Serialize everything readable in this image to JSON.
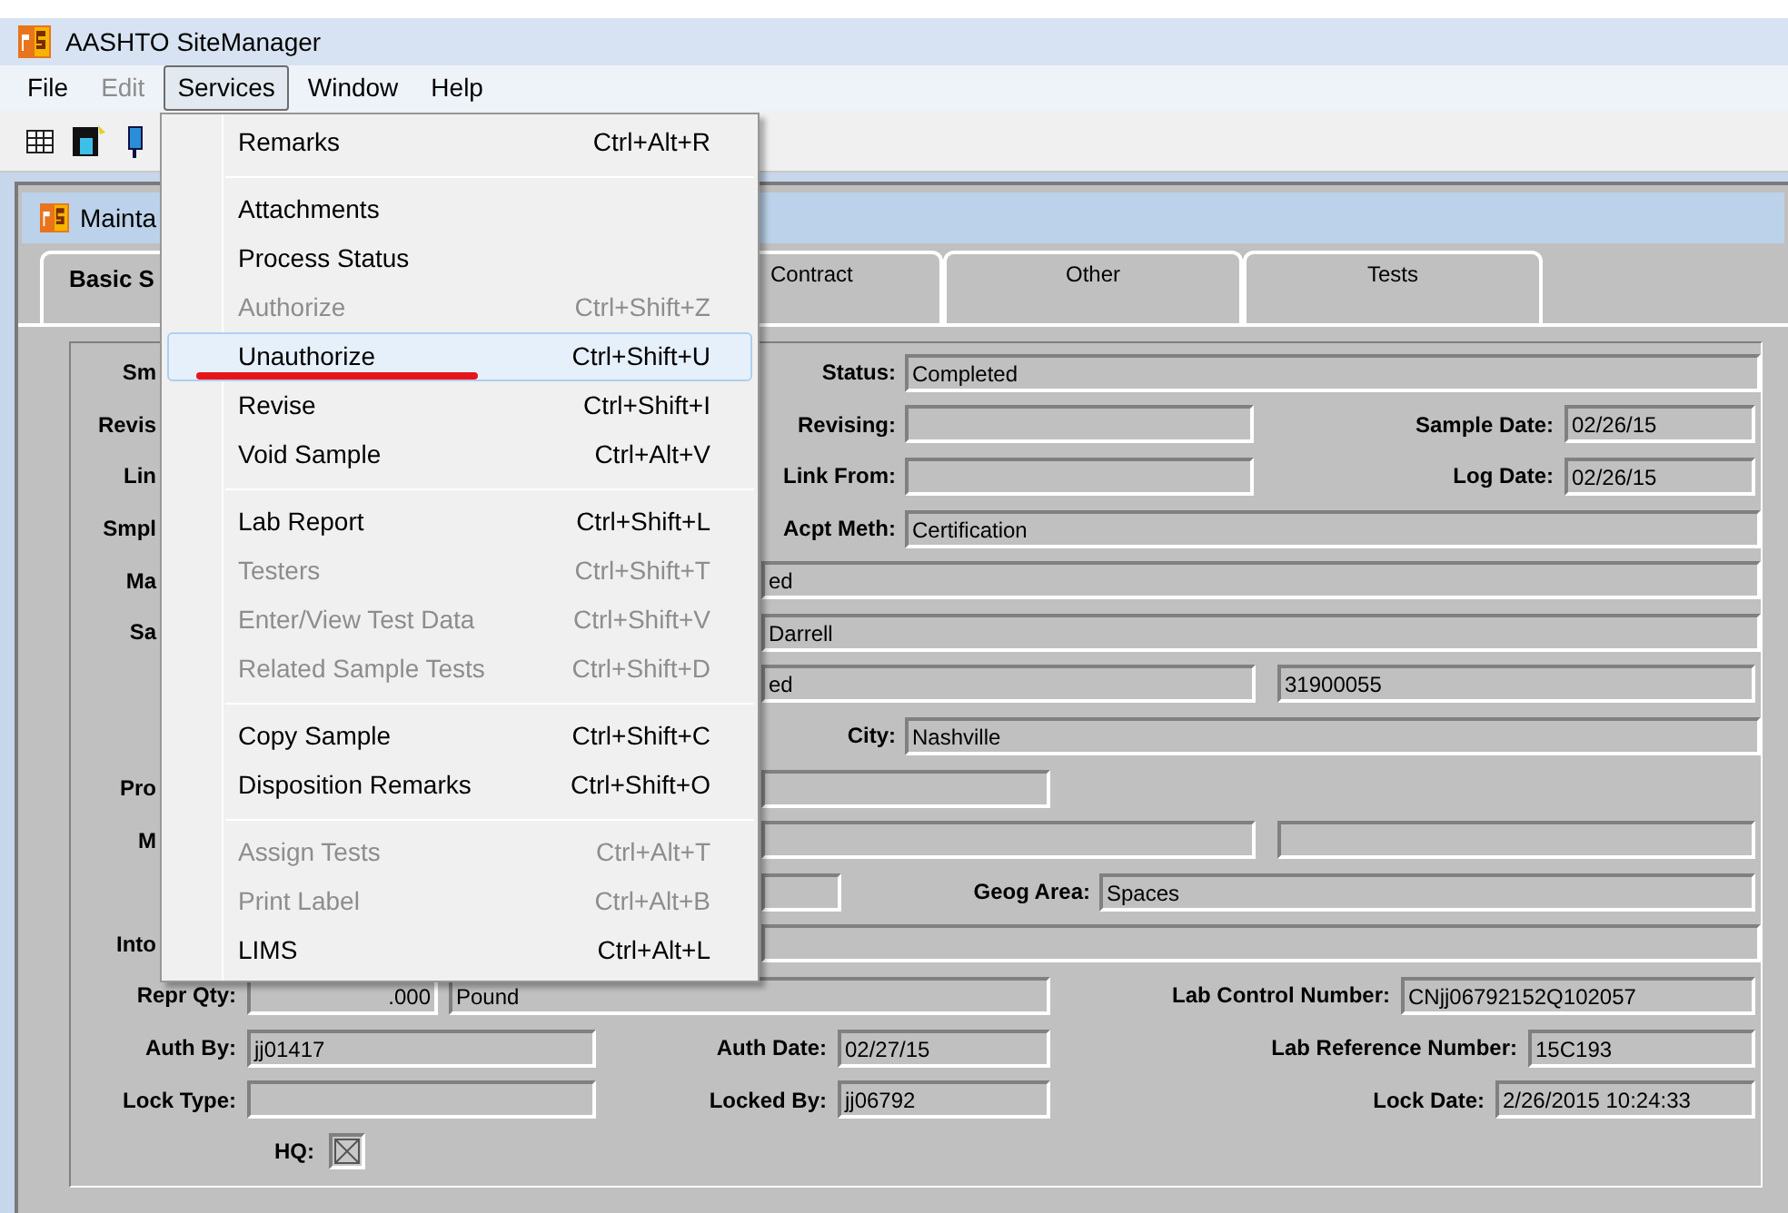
{
  "window": {
    "title": "AASHTO SiteManager"
  },
  "menubar": [
    {
      "label": "File",
      "disabled": false,
      "selected": false
    },
    {
      "label": "Edit",
      "disabled": true,
      "selected": false
    },
    {
      "label": "Services",
      "disabled": false,
      "selected": true
    },
    {
      "label": "Window",
      "disabled": false,
      "selected": false
    },
    {
      "label": "Help",
      "disabled": false,
      "selected": false
    }
  ],
  "child_window": {
    "title": "Mainta"
  },
  "tabs": [
    {
      "label": "Basic S",
      "selected": true
    },
    {
      "label": "Contract",
      "selected": false
    },
    {
      "label": "Other",
      "selected": false
    },
    {
      "label": "Tests",
      "selected": false
    }
  ],
  "form": {
    "rows": [
      {
        "items": [
          {
            "kind": "label",
            "text": "Sm"
          },
          {
            "kind": "label",
            "text": "Status:"
          },
          {
            "kind": "field",
            "value": "Completed"
          }
        ]
      },
      {
        "items": [
          {
            "kind": "label",
            "text": "Revis"
          },
          {
            "kind": "label",
            "text": "Revising:"
          },
          {
            "kind": "field"
          },
          {
            "kind": "label",
            "text": "Sample Date:"
          },
          {
            "kind": "field",
            "value": "02/26/15"
          }
        ]
      },
      {
        "items": [
          {
            "kind": "label",
            "text": "Lin"
          },
          {
            "kind": "label",
            "text": "Link From:"
          },
          {
            "kind": "field"
          },
          {
            "kind": "label",
            "text": "Log Date:"
          },
          {
            "kind": "field",
            "value": "02/26/15"
          }
        ]
      },
      {
        "items": [
          {
            "kind": "label",
            "text": "Smpl"
          },
          {
            "kind": "label",
            "text": "Acpt Meth:"
          },
          {
            "kind": "field",
            "value": "Certification"
          }
        ]
      },
      {
        "items": [
          {
            "kind": "label",
            "text": "Ma"
          },
          {
            "kind": "field",
            "value": "ed"
          }
        ]
      },
      {
        "items": [
          {
            "kind": "label",
            "text": "Sa"
          },
          {
            "kind": "field",
            "value": "Darrell"
          }
        ]
      },
      {
        "items": [
          {
            "kind": "field",
            "value": "ed"
          },
          {
            "kind": "field",
            "value": "31900055"
          }
        ]
      },
      {
        "items": [
          {
            "kind": "label",
            "text": "City:"
          },
          {
            "kind": "field",
            "value": "Nashville"
          }
        ]
      },
      {
        "items": [
          {
            "kind": "label",
            "text": "Pro"
          },
          {
            "kind": "field"
          }
        ]
      },
      {
        "items": [
          {
            "kind": "label",
            "text": "M"
          },
          {
            "kind": "field"
          },
          {
            "kind": "field"
          }
        ]
      },
      {
        "items": [
          {
            "kind": "field"
          },
          {
            "kind": "label",
            "text": "Geog Area:"
          },
          {
            "kind": "field",
            "value": "Spaces"
          }
        ]
      },
      {
        "items": [
          {
            "kind": "label",
            "text": "Into"
          },
          {
            "kind": "field"
          }
        ]
      },
      {
        "items": [
          {
            "kind": "label",
            "text": "Repr Qty:"
          },
          {
            "kind": "field",
            "value": ".000"
          },
          {
            "kind": "field",
            "value": "Pound"
          },
          {
            "kind": "label",
            "text": "Lab Control Number:"
          },
          {
            "kind": "field",
            "value": "CNjj06792152Q102057"
          }
        ]
      },
      {
        "items": [
          {
            "kind": "label",
            "text": "Auth By:"
          },
          {
            "kind": "field",
            "value": "jj01417"
          },
          {
            "kind": "label",
            "text": "Auth Date:"
          },
          {
            "kind": "field",
            "value": "02/27/15"
          },
          {
            "kind": "label",
            "text": "Lab Reference Number:"
          },
          {
            "kind": "field",
            "value": "15C193"
          }
        ]
      },
      {
        "items": [
          {
            "kind": "label",
            "text": "Lock Type:"
          },
          {
            "kind": "field"
          },
          {
            "kind": "label",
            "text": "Locked By:"
          },
          {
            "kind": "field",
            "value": "jj06792"
          },
          {
            "kind": "label",
            "text": "Lock Date:"
          },
          {
            "kind": "field",
            "value": "2/26/2015 10:24:33"
          }
        ]
      },
      {
        "items": [
          {
            "kind": "label",
            "text": "HQ:"
          },
          {
            "kind": "checkbox",
            "checked": true
          }
        ]
      }
    ]
  },
  "services_menu": {
    "groups": [
      {
        "items": [
          {
            "label": "Remarks",
            "shortcut": "Ctrl+Alt+R",
            "disabled": false,
            "selected": false
          }
        ]
      },
      {
        "items": [
          {
            "label": "Attachments",
            "disabled": false,
            "selected": false
          },
          {
            "label": "Process Status",
            "disabled": false,
            "selected": false
          },
          {
            "label": "Authorize",
            "shortcut": "Ctrl+Shift+Z",
            "disabled": true,
            "selected": false
          },
          {
            "label": "Unauthorize",
            "shortcut": "Ctrl+Shift+U",
            "disabled": false,
            "selected": true
          },
          {
            "label": "Revise",
            "shortcut": "Ctrl+Shift+I",
            "disabled": false,
            "selected": false
          },
          {
            "label": "Void Sample",
            "shortcut": "Ctrl+Alt+V",
            "disabled": false,
            "selected": false
          }
        ]
      },
      {
        "items": [
          {
            "label": "Lab Report",
            "shortcut": "Ctrl+Shift+L",
            "disabled": false,
            "selected": false
          },
          {
            "label": "Testers",
            "shortcut": "Ctrl+Shift+T",
            "disabled": true,
            "selected": false
          },
          {
            "label": "Enter/View Test Data",
            "shortcut": "Ctrl+Shift+V",
            "disabled": true,
            "selected": false
          },
          {
            "label": "Related Sample Tests",
            "shortcut": "Ctrl+Shift+D",
            "disabled": true,
            "selected": false
          }
        ]
      },
      {
        "items": [
          {
            "label": "Copy Sample",
            "shortcut": "Ctrl+Shift+C",
            "disabled": false,
            "selected": false
          },
          {
            "label": "Disposition Remarks",
            "shortcut": "Ctrl+Shift+O",
            "disabled": false,
            "selected": false
          }
        ]
      },
      {
        "items": [
          {
            "label": "Assign Tests",
            "shortcut": "Ctrl+Alt+T",
            "disabled": true,
            "selected": false
          },
          {
            "label": "Print Label",
            "shortcut": "Ctrl+Alt+B",
            "disabled": true,
            "selected": false
          },
          {
            "label": "LIMS",
            "shortcut": "Ctrl+Alt+L",
            "disabled": false,
            "selected": false
          }
        ]
      }
    ]
  }
}
